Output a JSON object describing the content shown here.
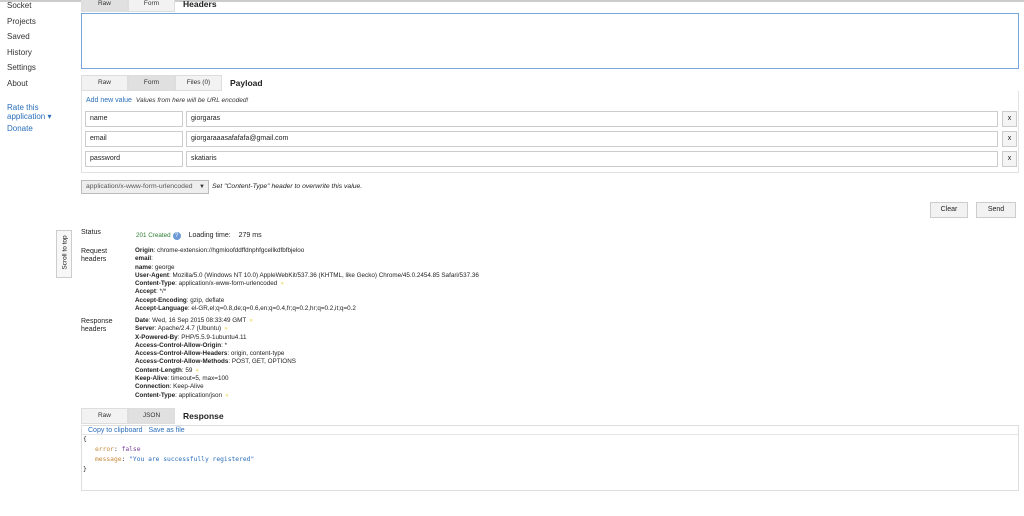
{
  "sidebar": {
    "items": [
      "Socket",
      "Projects",
      "Saved",
      "History",
      "Settings",
      "About"
    ],
    "rate": "Rate this application ▾",
    "donate": "Donate"
  },
  "headers": {
    "tabs": [
      "Raw",
      "Form"
    ],
    "title": "Headers"
  },
  "payload": {
    "tabs": [
      "Raw",
      "Form",
      "Files (0)"
    ],
    "title": "Payload",
    "add_new": "Add new value",
    "note": "Values from here will be URL encoded!",
    "rows": [
      {
        "key": "name",
        "value": "giorgaras"
      },
      {
        "key": "email",
        "value": "giorgaraaasafafafa@gmail.com"
      },
      {
        "key": "password",
        "value": "skatiaris"
      }
    ],
    "remove": "x"
  },
  "content_type": {
    "selected": "application/x-www-form-urlencoded",
    "hint": "Set \"Content-Type\" header to overwrite this value."
  },
  "actions": {
    "clear": "Clear",
    "send": "Send"
  },
  "scroll_to_top": "Scroll to top",
  "status": {
    "label": "Status",
    "code": "201 Created",
    "loading_label": "Loading time:",
    "loading_value": "279 ms"
  },
  "request_headers": {
    "label": "Request headers",
    "items": [
      {
        "k": "Origin",
        "v": "chrome-extension://hgmloofddffdnphfgcellkdfbfbjeloo"
      },
      {
        "k": "email",
        "v": ""
      },
      {
        "k": "name",
        "v": "george"
      },
      {
        "k": "User-Agent",
        "v": "Mozilla/5.0 (Windows NT 10.0) AppleWebKit/537.36 (KHTML, like Gecko) Chrome/45.0.2454.85 Safari/537.36"
      },
      {
        "k": "Content-Type",
        "v": "application/x-www-form-urlencoded"
      },
      {
        "k": "Accept",
        "v": "*/*"
      },
      {
        "k": "Accept-Encoding",
        "v": "gzip, deflate"
      },
      {
        "k": "Accept-Language",
        "v": "el-GR,el;q=0.8,de;q=0.6,en;q=0.4,fr;q=0.2,hr;q=0.2,it;q=0.2"
      }
    ]
  },
  "response_headers": {
    "label": "Response headers",
    "items": [
      {
        "k": "Date",
        "v": "Wed, 16 Sep 2015 08:33:49 GMT"
      },
      {
        "k": "Server",
        "v": "Apache/2.4.7 (Ubuntu)"
      },
      {
        "k": "X-Powered-By",
        "v": "PHP/5.5.9-1ubuntu4.11"
      },
      {
        "k": "Access-Control-Allow-Origin",
        "v": "*"
      },
      {
        "k": "Access-Control-Allow-Headers",
        "v": "origin, content-type"
      },
      {
        "k": "Access-Control-Allow-Methods",
        "v": "POST, GET, OPTIONS"
      },
      {
        "k": "Content-Length",
        "v": "59"
      },
      {
        "k": "Keep-Alive",
        "v": "timeout=5, max=100"
      },
      {
        "k": "Connection",
        "v": "Keep-Alive"
      },
      {
        "k": "Content-Type",
        "v": "application/json"
      }
    ]
  },
  "response": {
    "tabs": [
      "Raw",
      "JSON"
    ],
    "title": "Response",
    "copy": "Copy to clipboard",
    "save": "Save as file",
    "open": "{",
    "close": "}",
    "error_key": "error",
    "error_val": "false",
    "message_key": "message",
    "message_val": "\"You are successfully registered\""
  }
}
